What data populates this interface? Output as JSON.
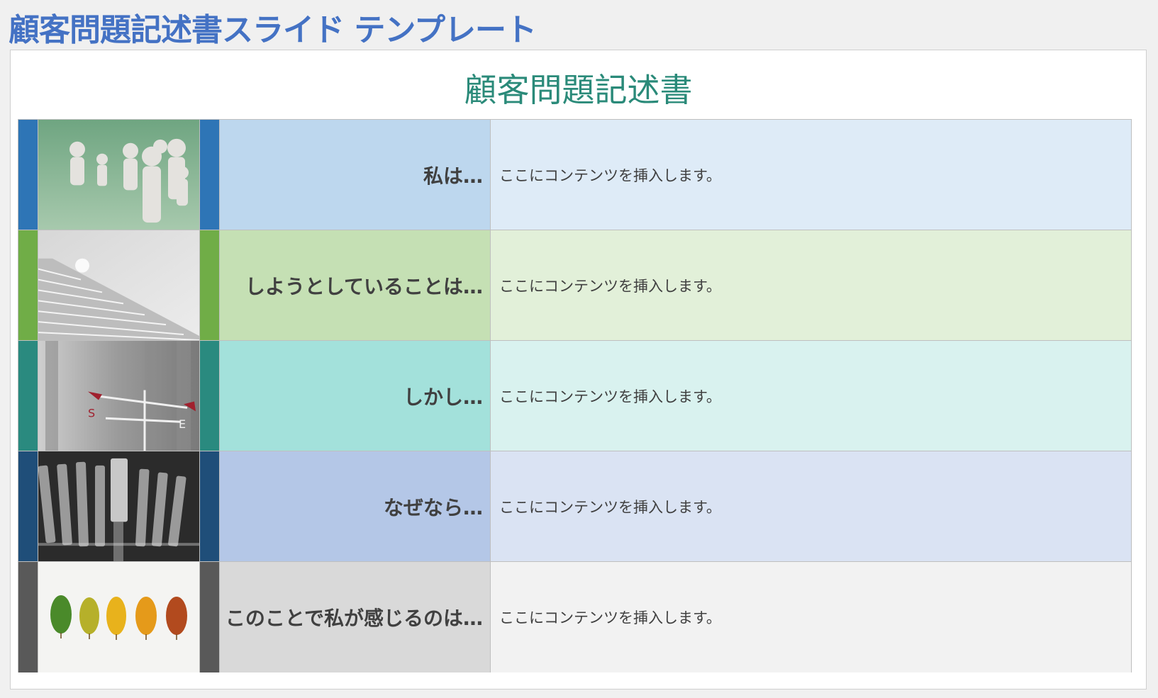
{
  "page": {
    "title": "顧客問題記述書スライド テンプレート"
  },
  "slide": {
    "title": "顧客問題記述書"
  },
  "rows": [
    {
      "label": "私は…",
      "content": "ここにコンテンツを挿入します。",
      "bar_color": "#2e75b6",
      "label_bg": "#bdd7ee",
      "content_bg": "#deebf7",
      "image_icon": "paper-people-photo"
    },
    {
      "label": "しようとしていることは…",
      "content": "ここにコンテンツを挿入します。",
      "bar_color": "#70ad47",
      "label_bg": "#c5e0b4",
      "content_bg": "#e2f0d9",
      "image_icon": "stairs-ball-photo"
    },
    {
      "label": "しかし…",
      "content": "ここにコンテンツを挿入します。",
      "bar_color": "#2a8a7f",
      "label_bg": "#a3e1db",
      "content_bg": "#d9f2ef",
      "image_icon": "weather-vane-photo"
    },
    {
      "label": "なぜなら…",
      "content": "ここにコンテンツを挿入します。",
      "bar_color": "#1f4e79",
      "label_bg": "#b4c7e7",
      "content_bg": "#dae3f3",
      "image_icon": "typewriter-keys-photo"
    },
    {
      "label": "このことで私が感じるのは…",
      "content": "ここにコンテンツを挿入します。",
      "bar_color": "#595959",
      "label_bg": "#d9d9d9",
      "content_bg": "#f2f2f2",
      "image_icon": "autumn-leaves-photo"
    }
  ]
}
